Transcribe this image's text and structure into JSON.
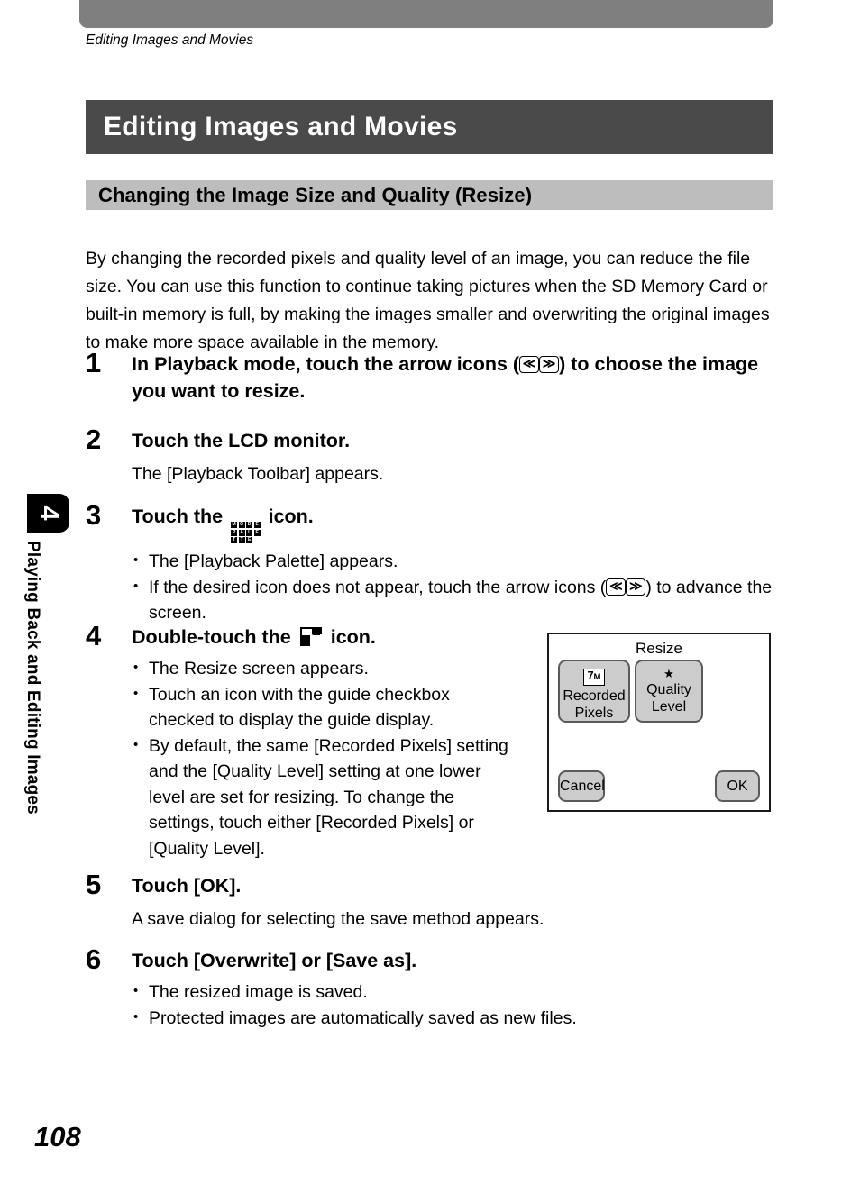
{
  "page": {
    "running_head": "Editing Images and Movies",
    "page_number": "108",
    "chapter_tab_number": "4",
    "chapter_title": "Playing Back and Editing Images"
  },
  "headings": {
    "h1": "Editing Images and Movies",
    "h2": "Changing the Image Size and Quality (Resize)"
  },
  "intro": "By changing the recorded pixels and quality level of an image, you can reduce the file size. You can use this function to continue taking pictures when the SD Memory Card or built-in memory is full, by making the images smaller and overwriting the original images to make more space available in the memory.",
  "steps": {
    "s1": {
      "number": "1",
      "head_part1": "In Playback mode, touch the arrow icons (",
      "head_part2": ") to choose the image you want to resize."
    },
    "s2": {
      "number": "2",
      "head": "Touch the LCD monitor.",
      "sub": "The [Playback Toolbar] appears."
    },
    "s3": {
      "number": "3",
      "head_part1": "Touch the",
      "head_part2": "icon.",
      "bullet1": "The [Playback Palette] appears.",
      "bullet2_part1": "If the desired icon does not appear, touch the arrow icons (",
      "bullet2_part2": ") to advance the screen."
    },
    "s4": {
      "number": "4",
      "head_part1": "Double-touch the",
      "head_part2": "icon.",
      "bullet1": "The Resize screen appears.",
      "bullet2": "Touch an icon with the guide checkbox checked to display the guide display.",
      "bullet3": "By default, the same [Recorded Pixels] setting and the [Quality Level] setting at one lower level are set for resizing. To change the settings, touch either [Recorded Pixels] or [Quality Level]."
    },
    "s5": {
      "number": "5",
      "head": "Touch [OK].",
      "sub": "A save dialog for selecting the save method appears."
    },
    "s6": {
      "number": "6",
      "head": "Touch [Overwrite] or [Save as].",
      "bullet1": "The resized image is saved.",
      "bullet2": "Protected images are automatically saved as new files."
    }
  },
  "lcd_screen": {
    "title": "Resize",
    "recorded_pixels_badge": "7",
    "recorded_pixels_badge_unit": "M",
    "recorded_pixels_line1": "Recorded",
    "recorded_pixels_line2": "Pixels",
    "quality_star": "★",
    "quality_line1": "Quality",
    "quality_line2": "Level",
    "cancel_label": "Cancel",
    "ok_label": "OK"
  },
  "icons": {
    "arrow_left": "≪",
    "arrow_right": "≫",
    "palette_letters": [
      "M",
      "O",
      "D",
      "E",
      "P",
      "A",
      "L",
      "E",
      "T",
      "T",
      "E",
      ""
    ]
  },
  "colors": {
    "top_bar": "#7f7f7f",
    "h1_bar": "#4a4a4a",
    "h2_bar": "#bdbdbd",
    "lcd_button": "#cccccc",
    "lcd_button_border": "#5a5a5a",
    "text": "#000000"
  }
}
